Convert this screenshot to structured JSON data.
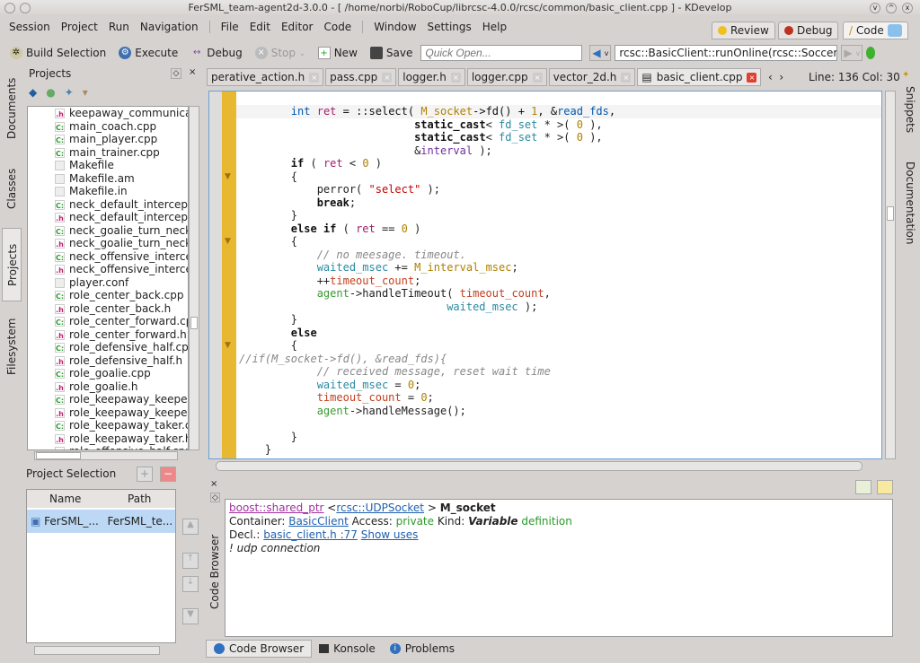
{
  "window": {
    "title": "FerSML_team-agent2d-3.0.0 - [ /home/norbi/RoboCup/librcsc-4.0.0/rcsc/common/basic_client.cpp ] - KDevelop"
  },
  "menu": [
    "Session",
    "Project",
    "Run",
    "Navigation",
    "File",
    "Edit",
    "Editor",
    "Code",
    "Window",
    "Settings",
    "Help"
  ],
  "areas": [
    {
      "label": "Review",
      "icon": "review-icon"
    },
    {
      "label": "Debug",
      "icon": "bug-icon"
    },
    {
      "label": "Code",
      "icon": "pencil-icon"
    }
  ],
  "toolbar": {
    "build": "Build Selection",
    "execute": "Execute",
    "debug": "Debug",
    "stop": "Stop",
    "new": "New",
    "save": "Save",
    "quick_open_placeholder": "Quick Open...",
    "context": "rcsc::BasicClient::runOnline(rcsc::SoccerA"
  },
  "left_tabs": [
    "Documents",
    "Classes",
    "Projects",
    "Filesystem"
  ],
  "projects": {
    "title": "Projects",
    "files": [
      {
        "name": "keepaway_communica",
        "t": "h"
      },
      {
        "name": "main_coach.cpp",
        "t": "c"
      },
      {
        "name": "main_player.cpp",
        "t": "c"
      },
      {
        "name": "main_trainer.cpp",
        "t": "c"
      },
      {
        "name": "Makefile",
        "t": "m"
      },
      {
        "name": "Makefile.am",
        "t": "m"
      },
      {
        "name": "Makefile.in",
        "t": "m"
      },
      {
        "name": "neck_default_intercept",
        "t": "c"
      },
      {
        "name": "neck_default_intercept",
        "t": "h"
      },
      {
        "name": "neck_goalie_turn_neck",
        "t": "c"
      },
      {
        "name": "neck_goalie_turn_neck",
        "t": "h"
      },
      {
        "name": "neck_offensive_interce",
        "t": "c"
      },
      {
        "name": "neck_offensive_interce",
        "t": "h"
      },
      {
        "name": "player.conf",
        "t": "m"
      },
      {
        "name": "role_center_back.cpp",
        "t": "c"
      },
      {
        "name": "role_center_back.h",
        "t": "h"
      },
      {
        "name": "role_center_forward.cp",
        "t": "c"
      },
      {
        "name": "role_center_forward.h",
        "t": "h"
      },
      {
        "name": "role_defensive_half.cpp",
        "t": "c"
      },
      {
        "name": "role_defensive_half.h",
        "t": "h"
      },
      {
        "name": "role_goalie.cpp",
        "t": "c"
      },
      {
        "name": "role_goalie.h",
        "t": "h"
      },
      {
        "name": "role_keepaway_keeper",
        "t": "c"
      },
      {
        "name": "role_keepaway_keeper",
        "t": "h"
      },
      {
        "name": "role_keepaway_taker.c",
        "t": "c"
      },
      {
        "name": "role_keepaway_taker.h",
        "t": "h"
      },
      {
        "name": "role_offensive_half.cpp",
        "t": "c"
      }
    ]
  },
  "project_selection": {
    "title": "Project Selection",
    "columns": [
      "Name",
      "Path"
    ],
    "rows": [
      [
        "FerSML_...",
        "FerSML_te..."
      ]
    ]
  },
  "tabs": [
    {
      "label": "perative_action.h"
    },
    {
      "label": "pass.cpp"
    },
    {
      "label": "logger.h"
    },
    {
      "label": "logger.cpp"
    },
    {
      "label": "vector_2d.h"
    },
    {
      "label": "basic_client.cpp",
      "active": true
    }
  ],
  "position": "Line: 136 Col: 30",
  "right_tabs": [
    "Snippets",
    "Documentation"
  ],
  "code": [
    [
      [
        "        ",
        ""
      ],
      [
        "int",
        "ty"
      ],
      [
        " ",
        ""
      ],
      [
        "ret",
        "va"
      ],
      [
        " = ::select( ",
        "fn"
      ],
      [
        "M_socket",
        "me"
      ],
      [
        "->fd() + ",
        "fn"
      ],
      [
        "1",
        "nu"
      ],
      [
        ", &",
        "fn"
      ],
      [
        "read_fds",
        "ty"
      ],
      [
        ",",
        "fn"
      ]
    ],
    [
      [
        "                           ",
        ""
      ],
      [
        "static_cast",
        "kw"
      ],
      [
        "< ",
        ""
      ],
      [
        "fd_set",
        "tc"
      ],
      [
        " * >( ",
        ""
      ],
      [
        "0",
        "nu"
      ],
      [
        " ),",
        ""
      ]
    ],
    [
      [
        "                           ",
        ""
      ],
      [
        "static_cast",
        "kw"
      ],
      [
        "< ",
        ""
      ],
      [
        "fd_set",
        "tc"
      ],
      [
        " * >( ",
        ""
      ],
      [
        "0",
        "nu"
      ],
      [
        " ),",
        ""
      ]
    ],
    [
      [
        "                           &",
        ""
      ],
      [
        "interval",
        "ip"
      ],
      [
        " );",
        ""
      ]
    ],
    [
      [
        "        ",
        ""
      ],
      [
        "if",
        "kw"
      ],
      [
        " ( ",
        ""
      ],
      [
        "ret",
        "va"
      ],
      [
        " < ",
        ""
      ],
      [
        "0",
        "nu"
      ],
      [
        " )",
        ""
      ]
    ],
    [
      [
        "        {",
        ""
      ]
    ],
    [
      [
        "            perror( ",
        ""
      ],
      [
        "\"select\"",
        "st"
      ],
      [
        " );",
        ""
      ]
    ],
    [
      [
        "            ",
        ""
      ],
      [
        "break",
        "kw"
      ],
      [
        ";",
        ""
      ]
    ],
    [
      [
        "        }",
        ""
      ]
    ],
    [
      [
        "        ",
        ""
      ],
      [
        "else if",
        "kw"
      ],
      [
        " ( ",
        ""
      ],
      [
        "ret",
        "va"
      ],
      [
        " == ",
        ""
      ],
      [
        "0",
        "nu"
      ],
      [
        " )",
        ""
      ]
    ],
    [
      [
        "        {",
        ""
      ]
    ],
    [
      [
        "            ",
        ""
      ],
      [
        "// no meesage. timeout.",
        "cm"
      ]
    ],
    [
      [
        "            ",
        ""
      ],
      [
        "waited_msec",
        "tc"
      ],
      [
        " += ",
        ""
      ],
      [
        "M_interval_msec",
        "me"
      ],
      [
        ";",
        ""
      ]
    ],
    [
      [
        "            ++",
        ""
      ],
      [
        "timeout_count",
        "tm"
      ],
      [
        ";",
        ""
      ]
    ],
    [
      [
        "            ",
        ""
      ],
      [
        "agent",
        "ag"
      ],
      [
        "->handleTimeout( ",
        ""
      ],
      [
        "timeout_count",
        "tm"
      ],
      [
        ",",
        ""
      ]
    ],
    [
      [
        "                                ",
        ""
      ],
      [
        "waited_msec",
        "tc"
      ],
      [
        " );",
        ""
      ]
    ],
    [
      [
        "        }",
        ""
      ]
    ],
    [
      [
        "        ",
        ""
      ],
      [
        "else",
        "kw"
      ]
    ],
    [
      [
        "        {",
        ""
      ]
    ],
    [
      [
        "//if(M_socket->fd(), &read_fds){",
        "cm"
      ]
    ],
    [
      [
        "            ",
        ""
      ],
      [
        "// received message, reset wait time",
        "cm"
      ]
    ],
    [
      [
        "            ",
        ""
      ],
      [
        "waited_msec",
        "tc"
      ],
      [
        " = ",
        ""
      ],
      [
        "0",
        "nu"
      ],
      [
        ";",
        ""
      ]
    ],
    [
      [
        "            ",
        ""
      ],
      [
        "timeout_count",
        "tm"
      ],
      [
        " = ",
        ""
      ],
      [
        "0",
        "nu"
      ],
      [
        ";",
        ""
      ]
    ],
    [
      [
        "            ",
        ""
      ],
      [
        "agent",
        "ag"
      ],
      [
        "->handleMessage();",
        ""
      ]
    ],
    [
      [
        "",
        ""
      ]
    ],
    [
      [
        "        }",
        ""
      ]
    ],
    [
      [
        "    }",
        ""
      ]
    ]
  ],
  "code_browser": {
    "title": "Code Browser",
    "type1": "boost::shared_ptr",
    "lt": " <",
    "type2": "rcsc::UDPSocket",
    "gt": " > ",
    "name": "M_socket",
    "container_label": "Container: ",
    "container": "BasicClient",
    "access_label": " Access: ",
    "access": "private",
    "kind_label": " Kind: ",
    "kind": "Variable",
    "kind_suffix": " definition",
    "decl_label": "Decl.: ",
    "decl": "basic_client.h :77",
    "show_uses": "Show uses",
    "comment": "! udp connection"
  },
  "bottom_tabs": [
    "Code Browser",
    "Konsole",
    "Problems"
  ],
  "colors": {
    "accent": "#6aa0d0",
    "gutter": "#e8b830",
    "selection": "#bcd8f4"
  }
}
